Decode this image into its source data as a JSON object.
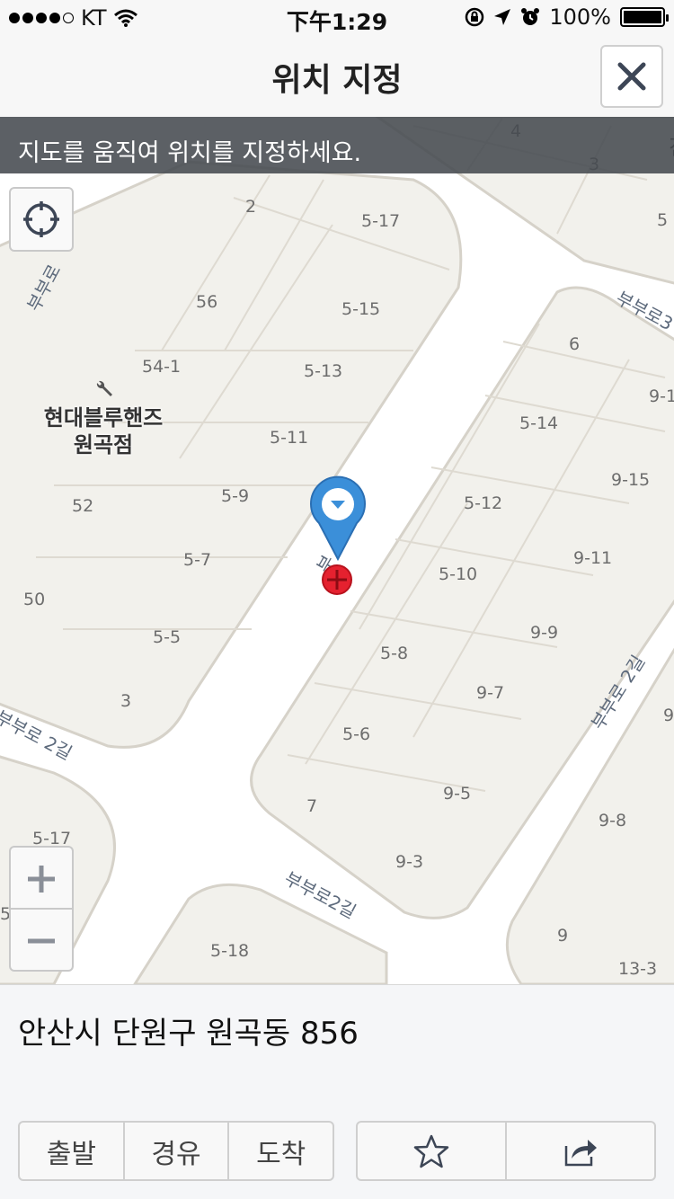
{
  "status_bar": {
    "carrier": "KT",
    "time": "下午1:29",
    "battery": "100%",
    "battery_level": 1.0,
    "signal_bars": 4
  },
  "nav": {
    "title": "위치 지정",
    "close_icon": "close-icon"
  },
  "banner": {
    "text": "지도를 움직여 위치를 지정하세요."
  },
  "map": {
    "building_numbers": [
      "2",
      "5-17",
      "56",
      "5-15",
      "54-1",
      "5-13",
      "5-11",
      "52",
      "5-9",
      "5-7",
      "50",
      "5-5",
      "3",
      "6",
      "9-1",
      "5-14",
      "9-15",
      "5-12",
      "9-11",
      "5-10",
      "9-9",
      "5-8",
      "9-7",
      "5-6",
      "9-5",
      "7",
      "9-8",
      "9-3",
      "9",
      "13-3",
      "5-17",
      "5-18",
      "4",
      "3",
      "5",
      "5",
      "9",
      "5"
    ],
    "road_labels": [
      "부부로",
      "부부로3",
      "부부로 2길",
      "부부로 2길",
      "부부로2길",
      "부"
    ],
    "poi": {
      "name": "현대블루핸즈\n원곡점",
      "line1": "현대블루핸즈",
      "line2": "원곡점",
      "icon": "wrench-icon"
    },
    "other_text": [
      "진"
    ],
    "colors": {
      "block_fill": "#f2f1ec",
      "block_stroke": "#d6d2c9",
      "pin_blue": "#3b8fd9",
      "pin_red": "#e5212f"
    }
  },
  "controls": {
    "gps_icon": "crosshair-icon",
    "zoom_in_icon": "plus-icon",
    "zoom_out_icon": "minus-icon"
  },
  "bottom": {
    "address": "안산시 단원구 원곡동 856",
    "route_buttons": [
      "출발",
      "경유",
      "도착"
    ],
    "favorite_icon": "star-icon",
    "share_icon": "share-icon"
  }
}
